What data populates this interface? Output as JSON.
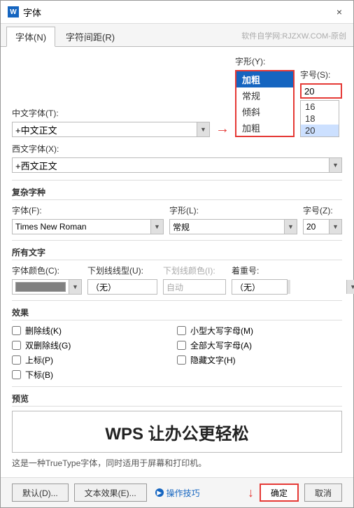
{
  "titleBar": {
    "icon": "W",
    "title": "字体",
    "closeLabel": "×"
  },
  "tabs": [
    {
      "id": "font",
      "label": "字体(N)",
      "active": true
    },
    {
      "id": "spacing",
      "label": "字符间距(R)",
      "active": false
    }
  ],
  "watermark": "软件自学网:RJZXW.COM-原创",
  "sections": {
    "chineseFont": {
      "label": "中文字体(T):",
      "value": "+中文正文"
    },
    "westernFont": {
      "label": "西文字体(X):",
      "value": "+西文正文"
    },
    "style": {
      "label": "字形(Y):",
      "options": [
        "加粗",
        "常规",
        "倾斜",
        "加粗"
      ],
      "selected": "加粗"
    },
    "size": {
      "label": "字号(S):",
      "value": "20",
      "options": [
        "16",
        "18",
        "20"
      ]
    },
    "complexScript": {
      "sectionLabel": "复杂字种",
      "fontLabel": "字体(F):",
      "fontValue": "Times New Roman",
      "styleLabel": "字形(L):",
      "styleValue": "常规",
      "sizeLabel": "字号(Z):",
      "sizeValue": "20"
    },
    "allText": {
      "sectionLabel": "所有文字",
      "fontColorLabel": "字体颜色(C):",
      "underlineLabel": "下划线线型(U):",
      "underlineValue": "（无）",
      "underlineColorLabel": "下划线颜色(I):",
      "underlineColorValue": "自动",
      "emphasisLabel": "着重号:",
      "emphasisValue": "（无）"
    },
    "effects": {
      "sectionLabel": "效果",
      "checkboxes": [
        {
          "id": "strikethrough",
          "label": "删除线(K)"
        },
        {
          "id": "doubleStrikethrough",
          "label": "双删除线(G)"
        },
        {
          "id": "superscript",
          "label": "上标(P)"
        },
        {
          "id": "subscript",
          "label": "下标(B)"
        }
      ],
      "checkboxesRight": [
        {
          "id": "smallCaps",
          "label": "小型大写字母(M)"
        },
        {
          "id": "allCaps",
          "label": "全部大写字母(A)"
        },
        {
          "id": "hidden",
          "label": "隐藏文字(H)"
        }
      ]
    },
    "preview": {
      "sectionLabel": "预览",
      "text": "WPS 让办公更轻松",
      "note": "这是一种TrueType字体，同时适用于屏幕和打印机。"
    }
  },
  "buttons": {
    "default": "默认(D)...",
    "textEffect": "文本效果(E)...",
    "tips": "操作技巧",
    "ok": "确定",
    "cancel": "取消"
  }
}
